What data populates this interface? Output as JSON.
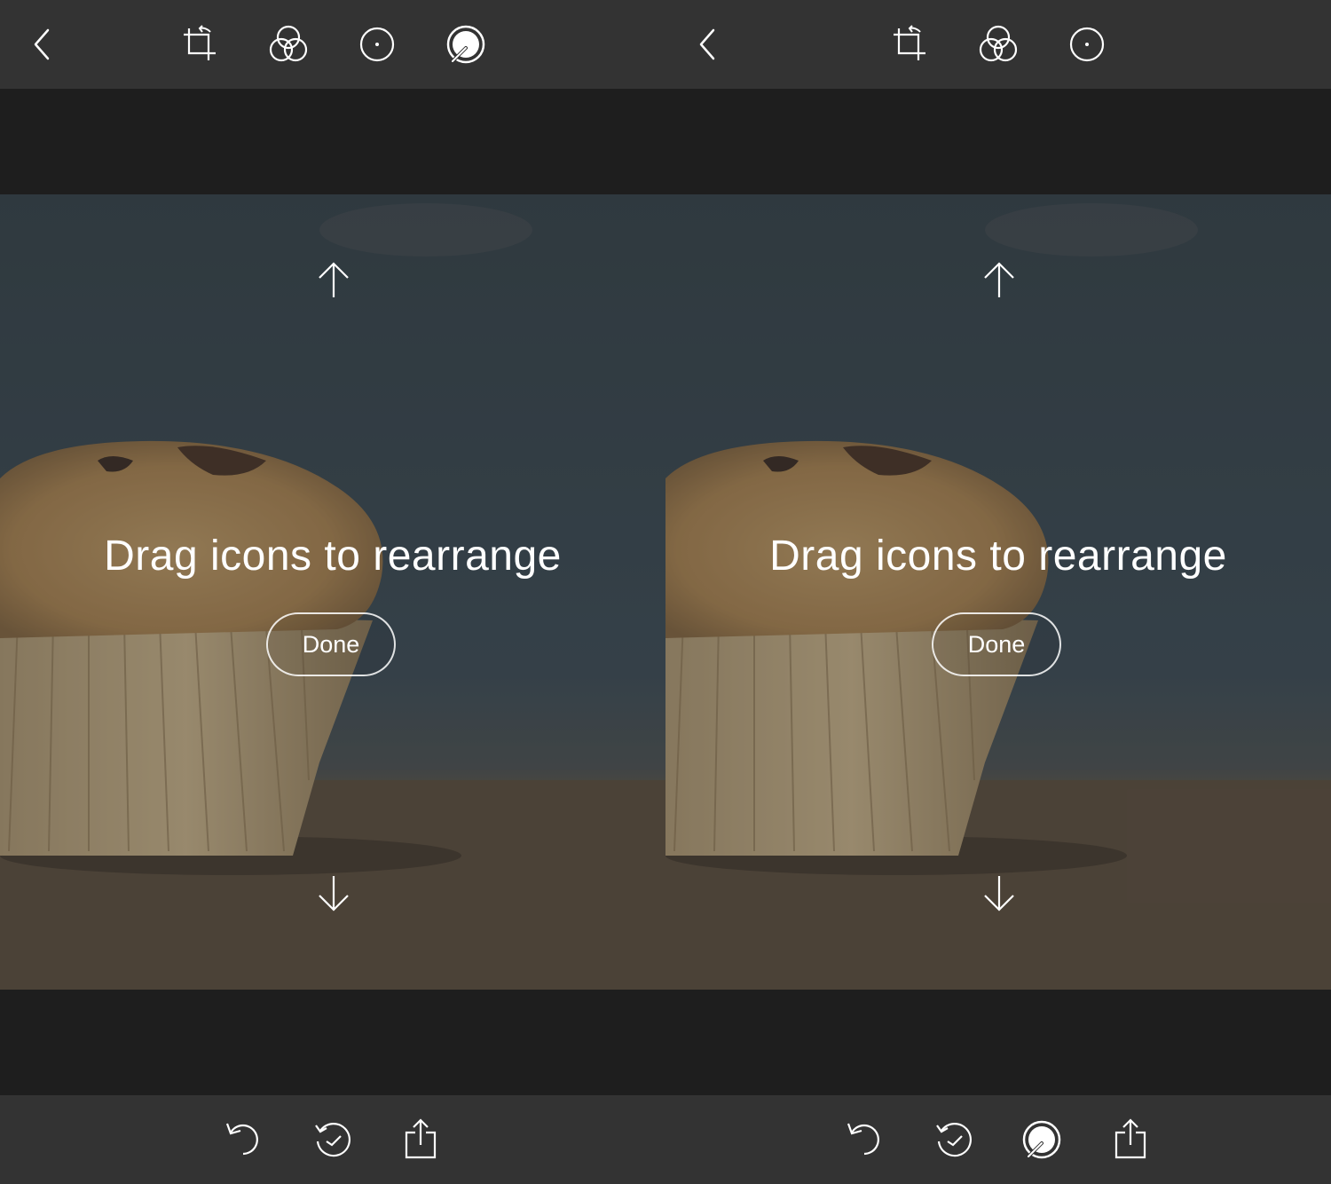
{
  "screens": [
    {
      "top_bar": {
        "back_icon": "chevron-left-icon",
        "tools": [
          "crop-rotate-icon",
          "filters-icon",
          "vignette-icon",
          "adjust-dial-icon"
        ]
      },
      "overlay": {
        "hint": "Drag icons to rearrange",
        "done_label": "Done",
        "up_icon": "arrow-up-icon",
        "down_icon": "arrow-down-icon"
      },
      "bottom_bar": {
        "tools": [
          "undo-icon",
          "history-icon",
          "share-icon"
        ]
      }
    },
    {
      "top_bar": {
        "back_icon": "chevron-left-icon",
        "tools": [
          "crop-rotate-icon",
          "filters-icon",
          "vignette-icon"
        ]
      },
      "overlay": {
        "hint": "Drag icons to rearrange",
        "done_label": "Done",
        "up_icon": "arrow-up-icon",
        "down_icon": "arrow-down-icon"
      },
      "bottom_bar": {
        "tools": [
          "undo-icon",
          "history-icon",
          "adjust-dial-icon",
          "share-icon"
        ]
      }
    }
  ],
  "colors": {
    "bar_background": "#333333",
    "canvas_background": "#1e1e1e",
    "icon_color": "#ffffff",
    "sky_color": "#3a4a55",
    "table_color": "#6b5a45"
  }
}
